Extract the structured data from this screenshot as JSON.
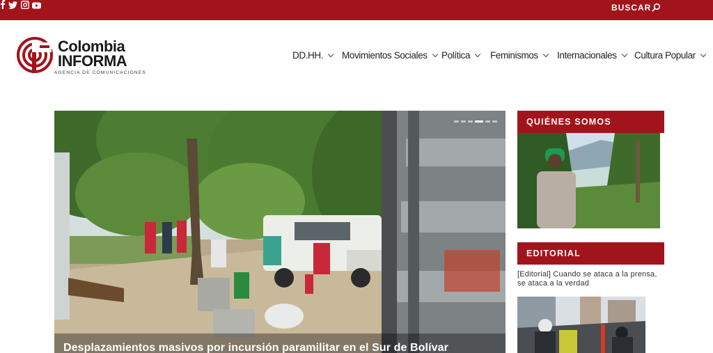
{
  "topbar": {
    "social_icons": [
      "facebook-icon",
      "twitter-icon",
      "instagram-icon",
      "youtube-icon"
    ],
    "search_label": "BUSCAR",
    "search_icon": "search-icon",
    "bg_color": "#a2141c"
  },
  "logo": {
    "line1": "Colombia",
    "line2": "INFORMA",
    "tagline": "AGENCIA DE COMUNICACIONES",
    "accent_color": "#a2141c"
  },
  "nav": {
    "items": [
      {
        "label": "DD.HH."
      },
      {
        "label": "Movimientos Sociales"
      },
      {
        "label": "Política"
      },
      {
        "label": "Feminismos"
      },
      {
        "label": "Internacionales"
      },
      {
        "label": "Cultura Popular"
      }
    ]
  },
  "hero": {
    "title": "Desplazamientos masivos por incursión paramilitar en el Sur de Bolívar",
    "slide_count": 6,
    "active_slide": 4
  },
  "sidebar": {
    "quienes_title": "QUIÉNES SOMOS",
    "editorial_title": "EDITORIAL",
    "editorial_link": "[Editorial] Cuando se ataca a la prensa, se ataca a la verdad"
  }
}
